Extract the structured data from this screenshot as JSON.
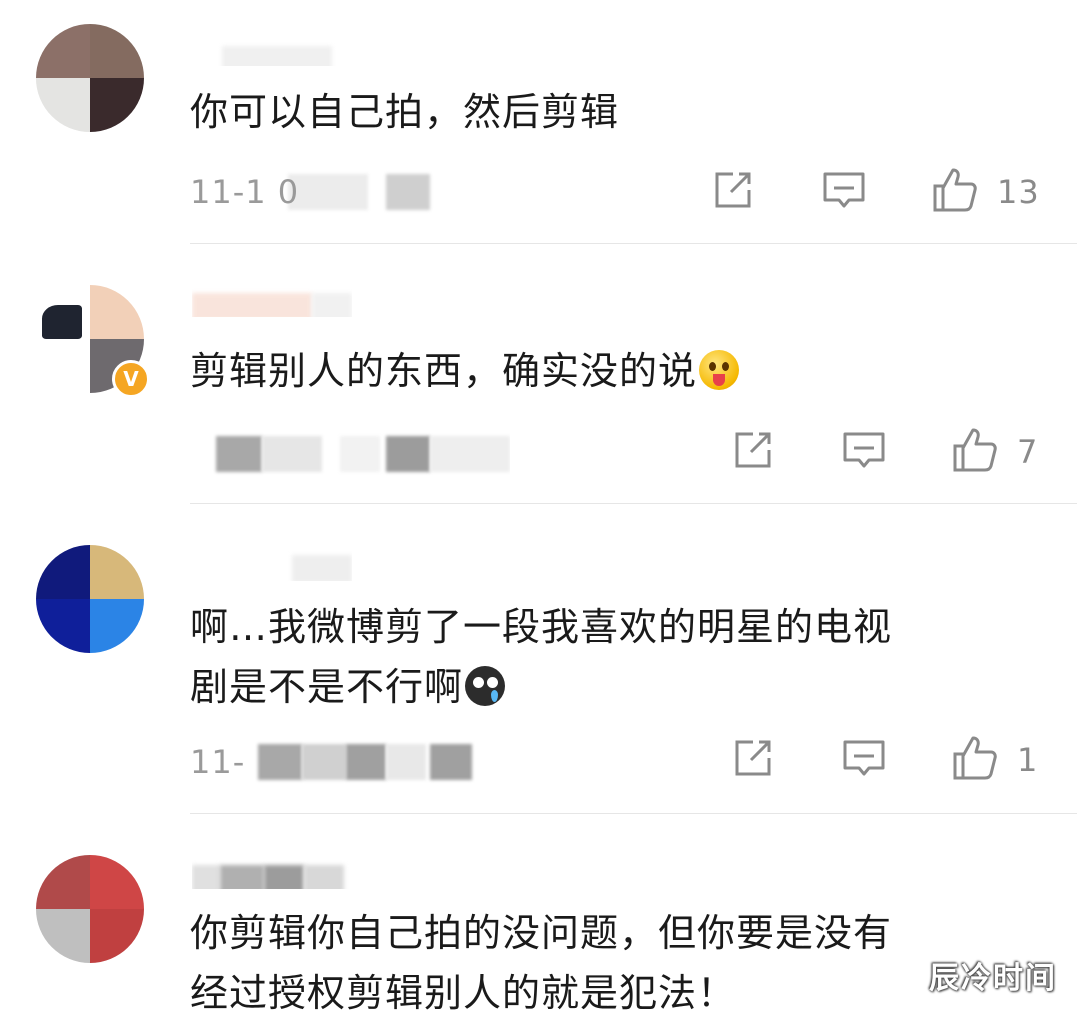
{
  "comments": [
    {
      "text": "你可以自己拍，然后剪辑",
      "time_prefix": "11-1 0",
      "like_count": "13"
    },
    {
      "text": "剪辑别人的东西，确实没的说",
      "time_prefix": "",
      "like_count": "7",
      "verified_mark": "V",
      "emoji": "tongue-emoji"
    },
    {
      "text_line1": "啊…我微博剪了一段我喜欢的明星的电视",
      "text_line2": "剧是不是不行啊",
      "time_prefix": "11-",
      "like_count": "1",
      "emoji": "crying-emoji"
    },
    {
      "text_line1": "你剪辑你自己拍的没问题，但你要是没有",
      "text_line2": "经过授权剪辑别人的就是犯法！"
    }
  ],
  "icons": {
    "share": "share-icon",
    "reply": "comment-icon",
    "like": "thumbs-up-icon"
  },
  "colors": {
    "text": "#1a1a1a",
    "meta": "#9a9a9a",
    "icon": "#8a8a8a",
    "verified": "#f5a623",
    "divider": "#e6e6e6"
  },
  "watermark": "辰冷时间"
}
